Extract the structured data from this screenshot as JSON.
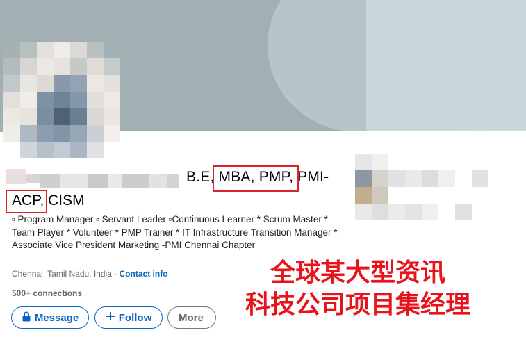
{
  "profile": {
    "name_credentials_line1": "B.E, MBA, PMP, PMI-",
    "name_credentials_line2": "ACP, CISM",
    "headline": "▫ Program Manager ▫ Servant Leader ▫Continuous Learner * Scrum Master * Team Player * Volunteer * PMP Trainer * IT Infrastructure Transition Manager * Associate Vice President Marketing -PMI Chennai Chapter",
    "location": "Chennai, Tamil Nadu, India · ",
    "contact_info_label": "Contact info",
    "connections": "500+ connections"
  },
  "actions": {
    "message_label": "Message",
    "follow_label": "Follow",
    "more_label": "More"
  },
  "overlay": {
    "line1": "全球某大型资讯",
    "line2": "科技公司项目集经理"
  },
  "colors": {
    "link": "#0a66c2",
    "annotation_red": "#d9232d",
    "banner": "#a2b0b3"
  }
}
